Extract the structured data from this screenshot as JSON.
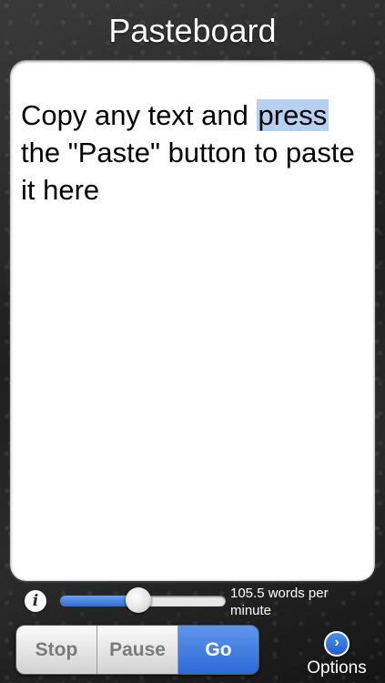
{
  "header": {
    "title": "Pasteboard"
  },
  "pasteboard": {
    "text_before": "Copy any text and ",
    "highlighted_word": "press",
    "text_after": " the \"Paste\" button to paste it here"
  },
  "speed": {
    "info_icon": "info-icon",
    "slider_fraction": 0.47,
    "label": "105.5 words per minute"
  },
  "controls": {
    "stop_label": "Stop",
    "pause_label": "Pause",
    "go_label": "Go",
    "active": "go"
  },
  "options": {
    "icon": "chevron-right-circle-icon",
    "label": "Options"
  },
  "colors": {
    "accent": "#2c6ad8",
    "highlight": "#b6d0ef"
  }
}
